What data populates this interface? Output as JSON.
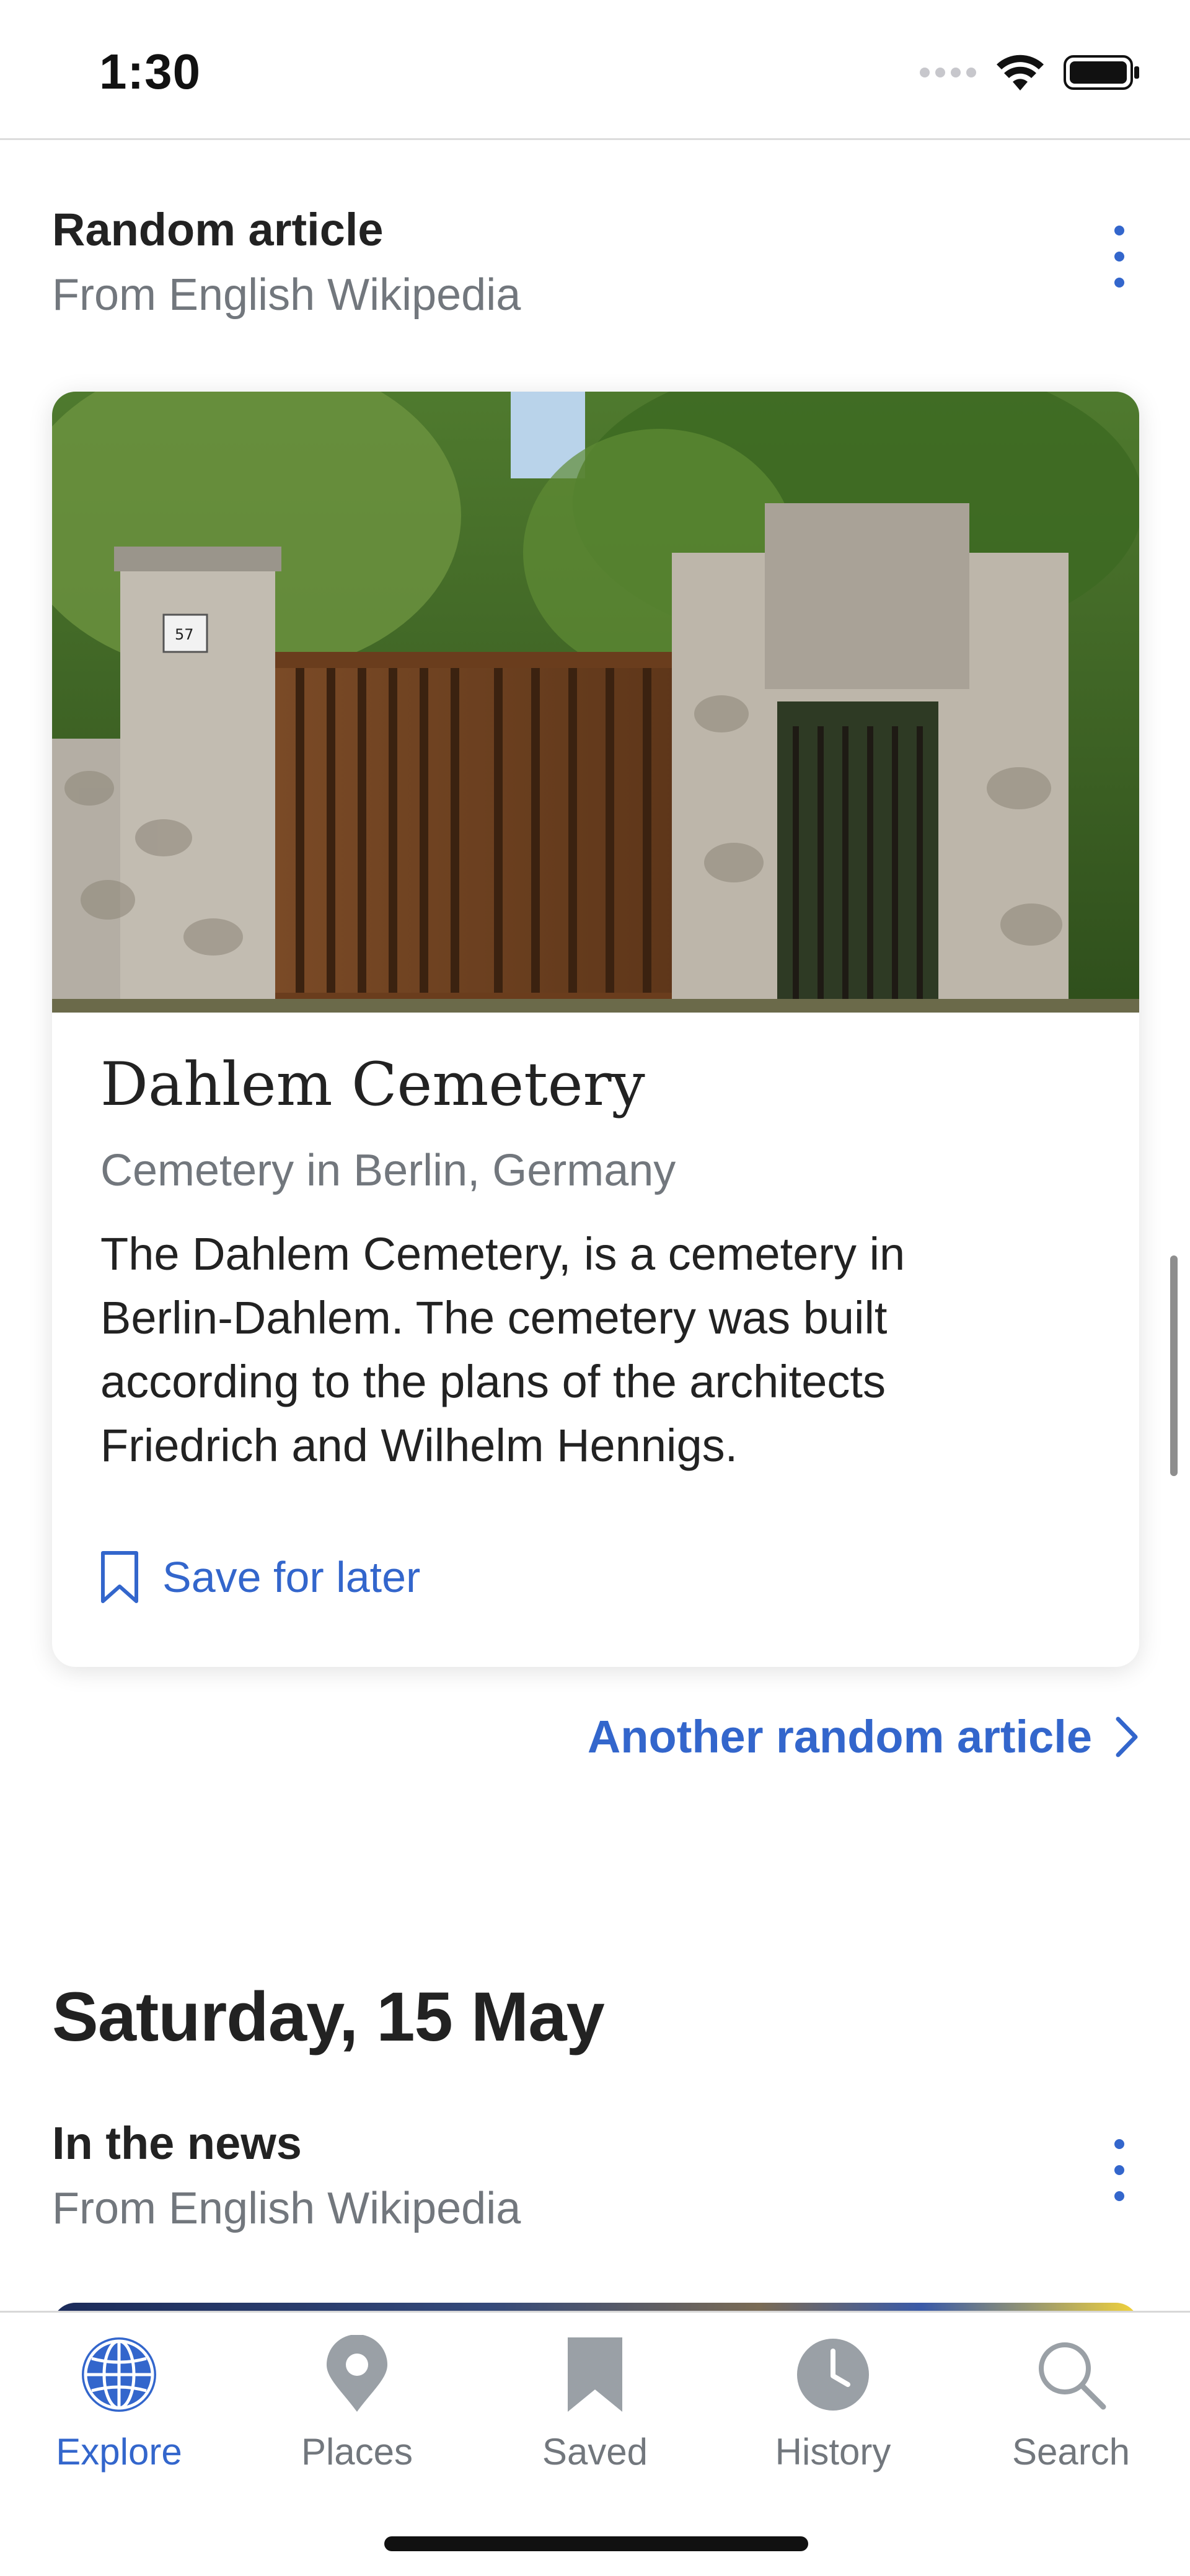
{
  "status_bar": {
    "time": "1:30"
  },
  "random_section": {
    "title": "Random article",
    "subtitle": "From English Wikipedia"
  },
  "article": {
    "title": "Dahlem Cemetery",
    "description": "Cemetery in Berlin, Germany",
    "extract_lines": [
      "The Dahlem Cemetery, is a cemetery in",
      "Berlin-Dahlem. The cemetery was built",
      "according to the plans of the architects",
      "Friedrich and Wilhelm Hennigs."
    ],
    "save_label": "Save for later",
    "gate_number": "57"
  },
  "another_random": {
    "label": "Another random article"
  },
  "date_heading": "Saturday, 15 May",
  "news_section": {
    "title": "In the news",
    "subtitle": "From English Wikipedia"
  },
  "tabs": [
    {
      "label": "Explore",
      "icon": "globe-icon",
      "active": true
    },
    {
      "label": "Places",
      "icon": "map-pin-icon",
      "active": false
    },
    {
      "label": "Saved",
      "icon": "bookmark-icon",
      "active": false
    },
    {
      "label": "History",
      "icon": "clock-icon",
      "active": false
    },
    {
      "label": "Search",
      "icon": "search-icon",
      "active": false
    }
  ],
  "colors": {
    "accent": "#3366cc",
    "secondary_text": "#72777d",
    "primary_text": "#222222"
  }
}
